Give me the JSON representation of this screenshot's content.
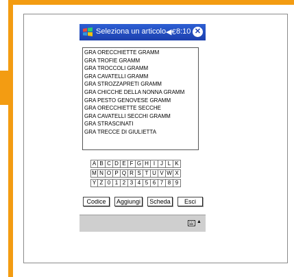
{
  "window": {
    "title": "Seleziona un articolo",
    "time": "8:10",
    "volume_icon": "◀€",
    "close_symbol": "✕"
  },
  "list": {
    "items": [
      "GRA ORECCHIETTE GRAMM",
      "GRA TROFIE GRAMM",
      "GRA TROCCOLI GRAMM",
      "GRA CAVATELLI GRAMM",
      "GRA STROZZAPRETI GRAMM",
      "GRA CHICCHE DELLA NONNA GRAMM",
      "GRA PESTO GENOVESE GRAMM",
      "GRA ORECCHIETTE SECCHE",
      "GRA CAVATELLI SECCHI GRAMM",
      "GRA STRASCINATI",
      "GRA TRECCE DI GIULIETTA"
    ]
  },
  "keypad": {
    "rows": [
      [
        "A",
        "B",
        "C",
        "D",
        "E",
        "F",
        "G",
        "H",
        "I",
        "J",
        "L",
        "K"
      ],
      [
        "M",
        "N",
        "O",
        "P",
        "Q",
        "R",
        "S",
        "T",
        "U",
        "V",
        "W",
        "X"
      ],
      [
        "Y",
        "Z",
        "0",
        "1",
        "2",
        "3",
        "4",
        "5",
        "6",
        "7",
        "8",
        "9"
      ]
    ]
  },
  "buttons": {
    "codice": "Codice",
    "aggiungi": "Aggiungi",
    "scheda": "Scheda",
    "esci": "Esci"
  },
  "colors": {
    "frame_accent": "#f39c12",
    "titlebar": "#1c3fae",
    "menubar": "#cfcfcf"
  },
  "icons": {
    "start": "windows-flag-icon",
    "volume": "speaker-icon",
    "close": "close-icon",
    "keyboard": "keyboard-icon",
    "sip_toggle": "up-arrow-icon"
  }
}
